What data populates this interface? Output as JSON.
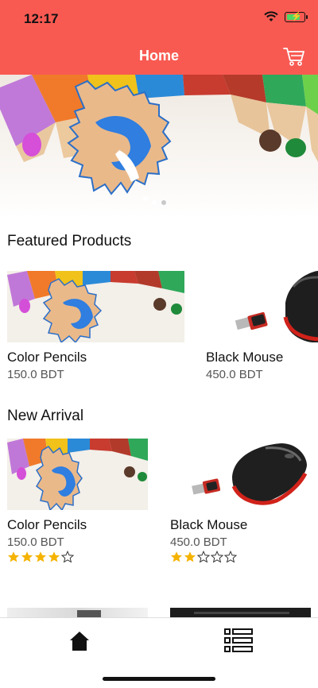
{
  "status": {
    "time": "12:17"
  },
  "header": {
    "title": "Home"
  },
  "featured": {
    "title": "Featured Products",
    "items": [
      {
        "name": "Color Pencils",
        "price": "150.0 BDT"
      },
      {
        "name": "Black Mouse",
        "price": "450.0 BDT"
      }
    ]
  },
  "new_arrival": {
    "title": "New Arrival",
    "items": [
      {
        "name": "Color Pencils",
        "price": "150.0 BDT",
        "rating": 4
      },
      {
        "name": "Black Mouse",
        "price": "450.0 BDT",
        "rating": 2
      }
    ]
  },
  "carousel": {
    "slides": 2,
    "active": 1
  },
  "colors": {
    "accent": "#f85a52",
    "star": "#f5b301"
  },
  "icons": [
    "wifi-icon",
    "battery-icon",
    "cart-icon",
    "home-icon",
    "list-icon",
    "star-icon"
  ]
}
